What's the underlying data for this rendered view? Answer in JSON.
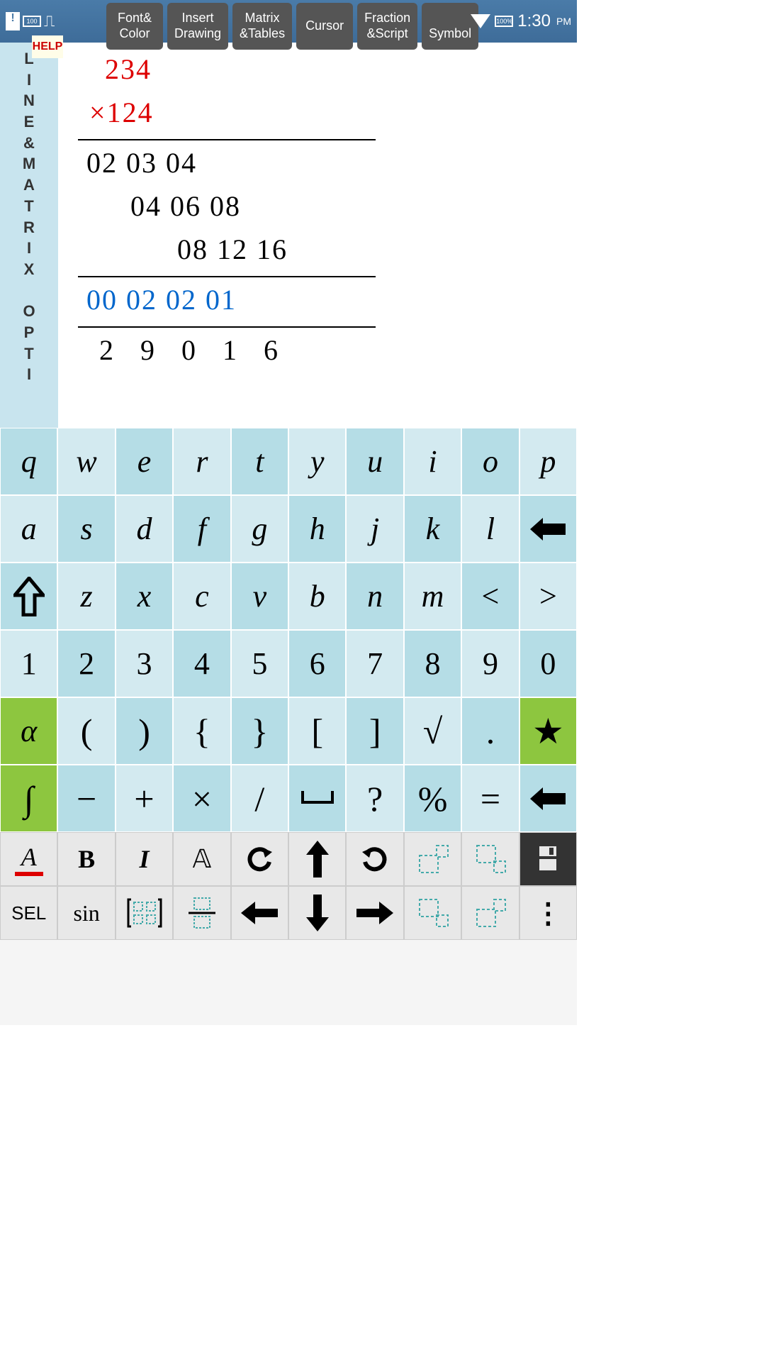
{
  "status": {
    "time": "1:30",
    "ampm": "PM",
    "battery": "100%"
  },
  "help_label": "HELP",
  "tabs": [
    {
      "line1": "Font&",
      "line2": "Color"
    },
    {
      "line1": "Insert",
      "line2": "Drawing"
    },
    {
      "line1": "Matrix",
      "line2": "&Tables"
    },
    {
      "line1": "Cursor",
      "line2": ""
    },
    {
      "line1": "Fraction",
      "line2": "&Script"
    },
    {
      "line1": "",
      "line2": "Symbol"
    }
  ],
  "sidebar_text": "L\nI\nN\nE\n&\nM\nA\nT\nR\nI\nX\n \nO\nP\nT\nI",
  "math": {
    "operand1": "234",
    "operand2_prefix": "×",
    "operand2": "124",
    "partial1": "02 03 04",
    "partial2": "04 06 08",
    "partial3": "08 12 16",
    "carries": "00 02 02 01",
    "result": "2   9   0   1   6"
  },
  "keyboard": {
    "row1": [
      "q",
      "w",
      "e",
      "r",
      "t",
      "y",
      "u",
      "i",
      "o",
      "p"
    ],
    "row2": [
      "a",
      "s",
      "d",
      "f",
      "g",
      "h",
      "j",
      "k",
      "l",
      "⬅"
    ],
    "row3": [
      "⇧",
      "z",
      "x",
      "c",
      "v",
      "b",
      "n",
      "m",
      "<",
      ">"
    ],
    "row4": [
      "1",
      "2",
      "3",
      "4",
      "5",
      "6",
      "7",
      "8",
      "9",
      "0"
    ],
    "row5": [
      "α",
      "(",
      ")",
      "{",
      "}",
      "[",
      "]",
      "√",
      ".",
      "★"
    ],
    "row6": [
      "∫",
      "−",
      "+",
      "×",
      "/",
      "␣",
      "?",
      "%",
      "=",
      "⬅"
    ]
  },
  "toolbar1": [
    "A",
    "B",
    "I",
    "𝔸",
    "↶",
    "↑",
    "↷",
    "▫",
    "▫",
    "💾"
  ],
  "toolbar2": [
    "SEL",
    "sin",
    "▦",
    "▭",
    "←",
    "↓",
    "→",
    "▫",
    "▫",
    "⋮"
  ],
  "colors": {
    "red": "#d00",
    "blue": "#06c",
    "green_key": "#8dc63f"
  }
}
